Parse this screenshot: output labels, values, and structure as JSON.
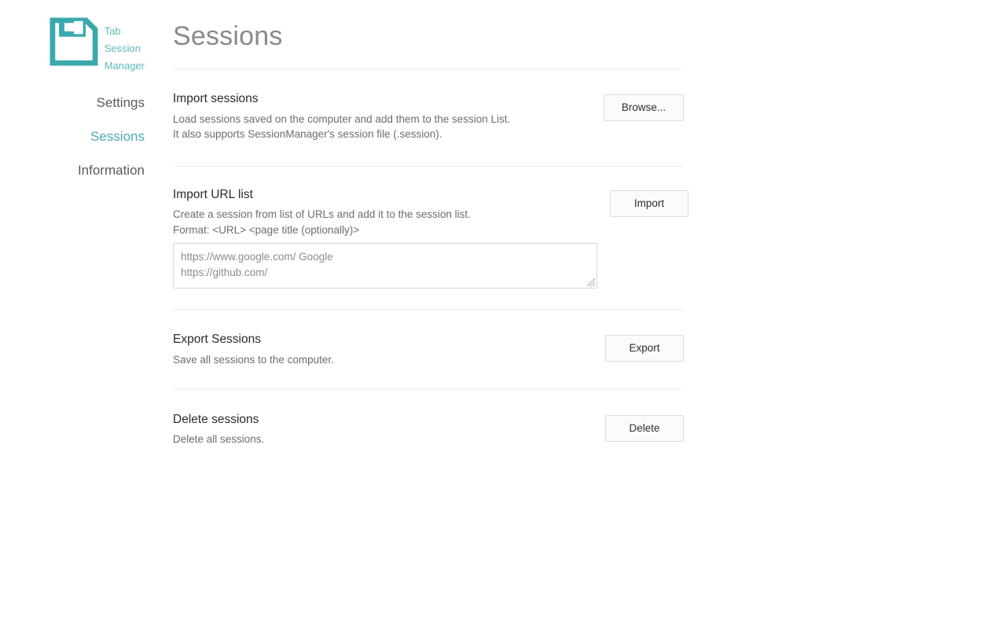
{
  "brand": {
    "logo_icon": "floppy-disk-save-icon",
    "name_lines": [
      "Tab",
      "Session",
      "Manager"
    ],
    "accent_color": "#3aa9ae",
    "name_color": "#5fb8bd"
  },
  "sidebar": {
    "items": [
      {
        "label": "Settings",
        "active": false
      },
      {
        "label": "Sessions",
        "active": true
      },
      {
        "label": "Information",
        "active": false
      }
    ]
  },
  "header": {
    "title": "Sessions"
  },
  "sections": {
    "import_sessions": {
      "title": "Import sessions",
      "desc_line1": "Load sessions saved on the computer and add them to the session List.",
      "desc_line2": "It also supports SessionManager's session file (.session).",
      "button_label": "Browse..."
    },
    "import_url_list": {
      "title": "Import URL list",
      "desc_line1": "Create a session from list of URLs and add it to the session list.",
      "desc_line2": "Format: <URL>  <page title (optionally)>",
      "textarea_value": "",
      "textarea_placeholder": "https://www.google.com/ Google\nhttps://github.com/",
      "button_label": "Import"
    },
    "export_sessions": {
      "title": "Export Sessions",
      "desc_line1": "Save all sessions to the computer.",
      "button_label": "Export"
    },
    "delete_sessions": {
      "title": "Delete sessions",
      "desc_line1": "Delete all sessions.",
      "button_label": "Delete"
    }
  }
}
